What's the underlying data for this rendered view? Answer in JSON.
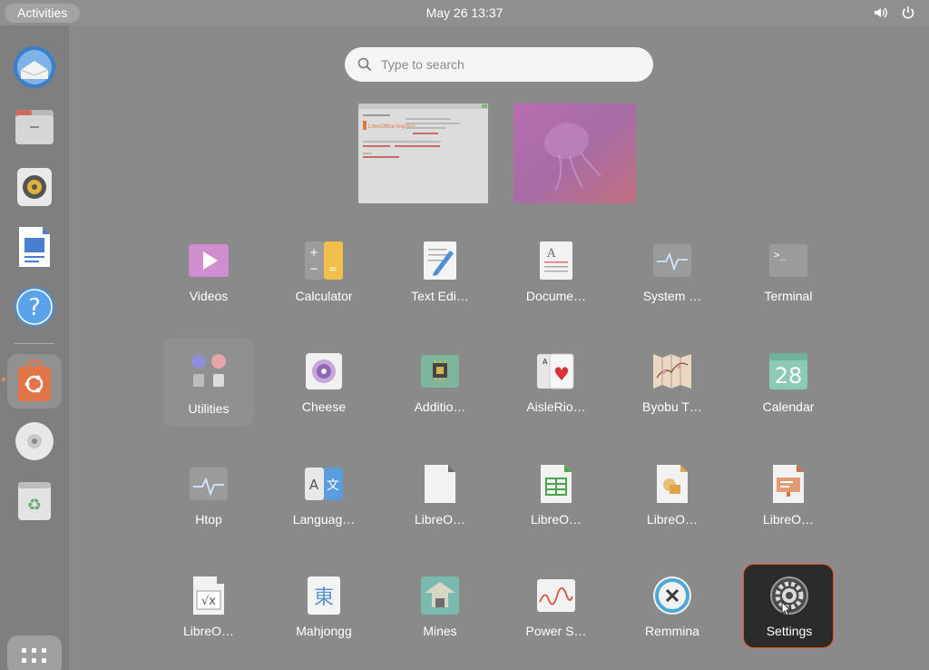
{
  "topbar": {
    "activities_label": "Activities",
    "clock": "May 26  13:37"
  },
  "search": {
    "placeholder": "Type to search"
  },
  "workspace1": {
    "title": "LibreOffice Impress",
    "logo_text": "LibreOffice Impress"
  },
  "apps": [
    {
      "label": "Videos",
      "icon": "videos-icon"
    },
    {
      "label": "Calculator",
      "icon": "calculator-icon"
    },
    {
      "label": "Text Edi…",
      "icon": "text-editor-icon"
    },
    {
      "label": "Docume…",
      "icon": "document-viewer-icon"
    },
    {
      "label": "System …",
      "icon": "system-monitor-icon"
    },
    {
      "label": "Terminal",
      "icon": "terminal-icon"
    },
    {
      "label": "Utilities",
      "icon": "utilities-folder-icon"
    },
    {
      "label": "Cheese",
      "icon": "cheese-icon"
    },
    {
      "label": "Additio…",
      "icon": "additional-drivers-icon"
    },
    {
      "label": "AisleRio…",
      "icon": "aisleriot-icon"
    },
    {
      "label": "Byobu T…",
      "icon": "byobu-icon"
    },
    {
      "label": "Calendar",
      "icon": "calendar-icon",
      "day": "28"
    },
    {
      "label": "Htop",
      "icon": "htop-icon"
    },
    {
      "label": "Languag…",
      "icon": "language-support-icon"
    },
    {
      "label": "LibreO…",
      "icon": "libreoffice-icon"
    },
    {
      "label": "LibreO…",
      "icon": "libreoffice-calc-icon"
    },
    {
      "label": "LibreO…",
      "icon": "libreoffice-draw-icon"
    },
    {
      "label": "LibreO…",
      "icon": "libreoffice-impress-icon"
    },
    {
      "label": "LibreO…",
      "icon": "libreoffice-math-icon"
    },
    {
      "label": "Mahjongg",
      "icon": "mahjongg-icon"
    },
    {
      "label": "Mines",
      "icon": "mines-icon"
    },
    {
      "label": "Power S…",
      "icon": "power-statistics-icon"
    },
    {
      "label": "Remmina",
      "icon": "remmina-icon"
    },
    {
      "label": "Settings",
      "icon": "settings-icon"
    }
  ],
  "dock": [
    "thunderbird-icon",
    "files-icon",
    "rhythmbox-icon",
    "libreoffice-writer-icon",
    "help-icon",
    "app-center-icon",
    "disc-icon",
    "trash-icon"
  ],
  "colors": {
    "accent": "#e9531f",
    "overlay": "#8a8a8a"
  }
}
